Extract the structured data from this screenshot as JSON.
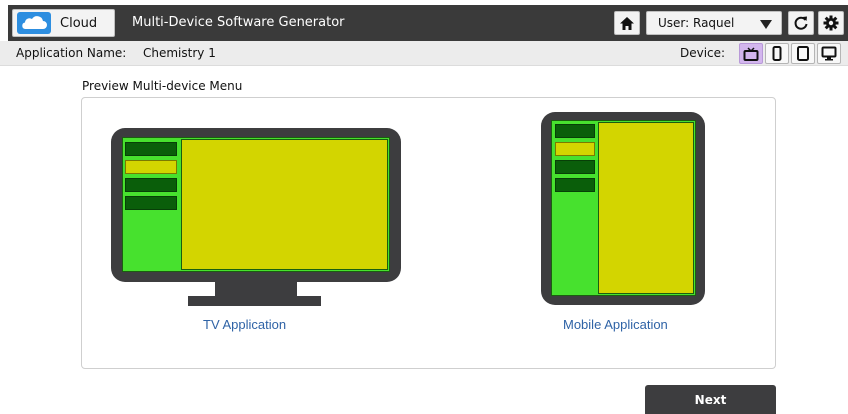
{
  "header": {
    "logo_label": "Cloud",
    "title": "Multi-Device Software Generator",
    "user_label": "User: Raquel",
    "icons": [
      "cloud-icon",
      "home-icon",
      "chevron-down-icon",
      "refresh-icon",
      "gear-icon"
    ]
  },
  "subheader": {
    "app_name_label": "Application Name:",
    "app_name_value": "Chemistry 1",
    "device_label": "Device:",
    "devices": [
      "tv",
      "mobile",
      "tablet",
      "desktop"
    ],
    "active_device": "tv"
  },
  "preview": {
    "title": "Preview Multi-device Menu",
    "tv_caption": "TV Application",
    "mobile_caption": "Mobile Application",
    "tv_menu_items": 4,
    "mobile_menu_items": 4,
    "selected_menu_item": 2
  },
  "footer": {
    "next_label": "Next"
  },
  "colors": {
    "header_bg": "#3a3a3a",
    "device_frame": "#3d3d3f",
    "sidebar_green": "#47e12e",
    "content_yellow": "#d3d500",
    "menu_dark_green": "#0a5e0a",
    "active_device_purple": "#d3b6ee",
    "caption_blue": "#2f63a6"
  }
}
